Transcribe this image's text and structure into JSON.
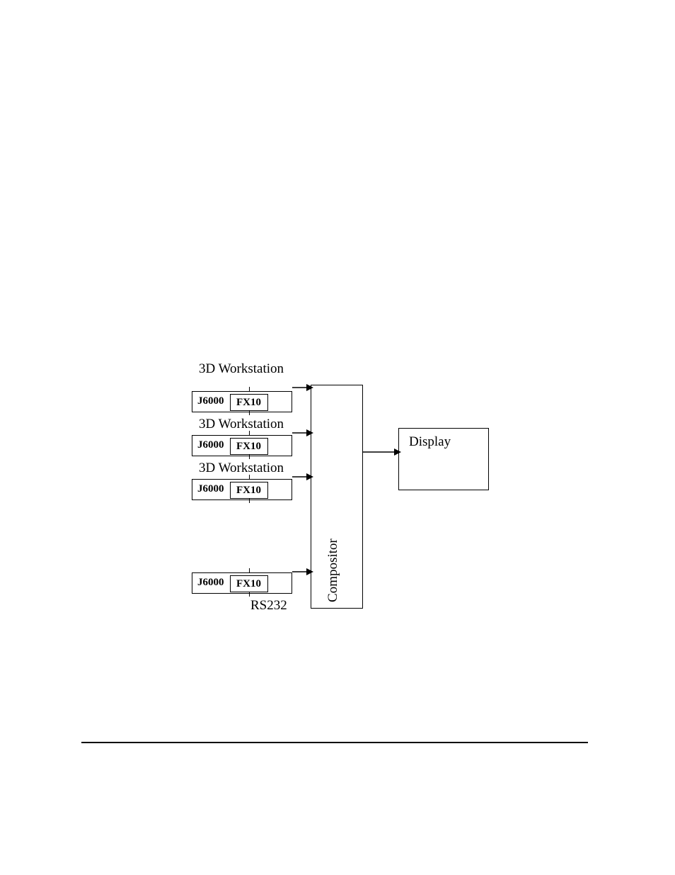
{
  "diagram": {
    "ws_label": "3D Workstation",
    "workstations": [
      {
        "host": "J6000",
        "card": "FX10"
      },
      {
        "host": "J6000",
        "card": "FX10"
      },
      {
        "host": "J6000",
        "card": "FX10"
      },
      {
        "host": "J6000",
        "card": "FX10"
      }
    ],
    "compositor_label": "Compositor",
    "display_label": "Display",
    "serial_label": "RS232"
  }
}
